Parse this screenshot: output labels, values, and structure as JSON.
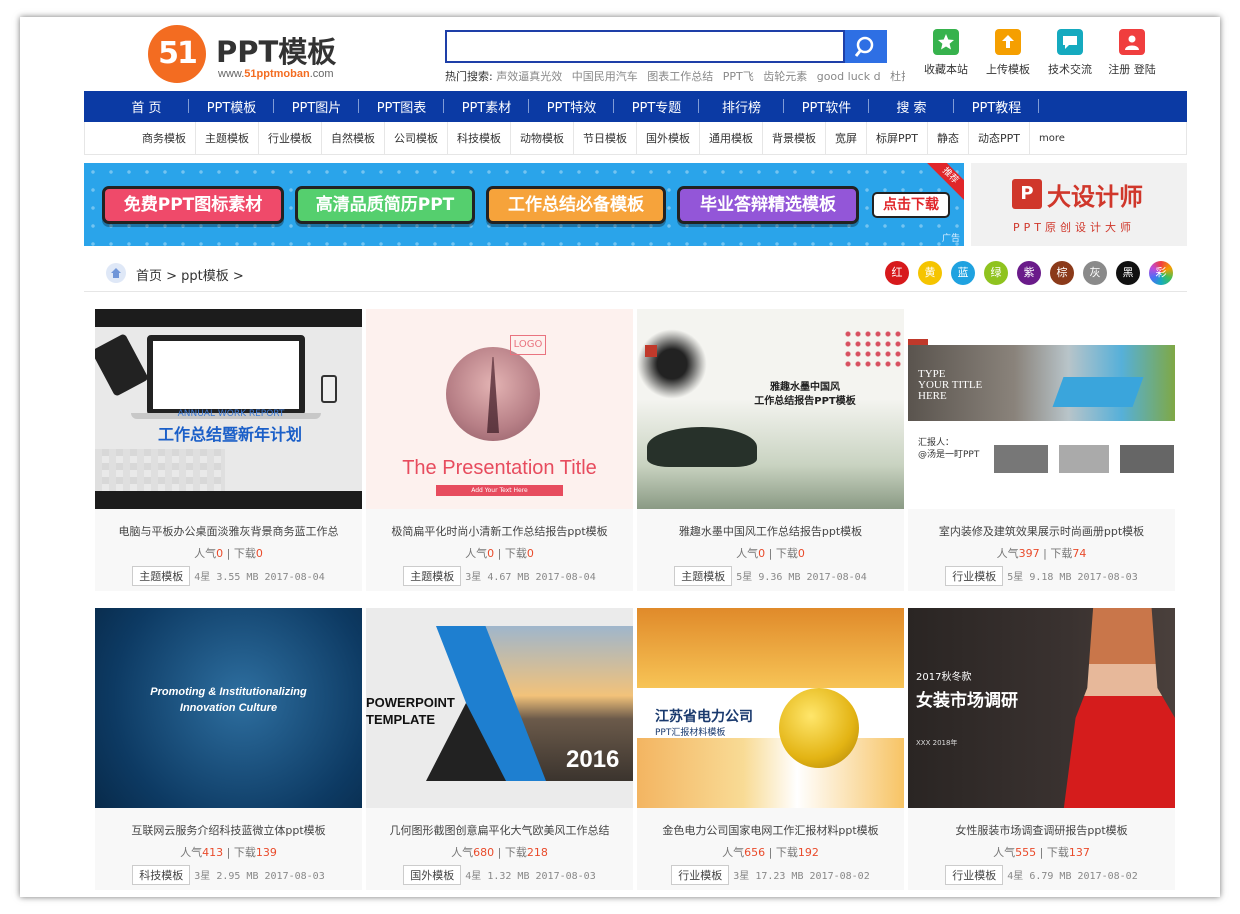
{
  "header": {
    "logo_mark": "51",
    "logo_title": "PPT模板",
    "logo_url_prefix": "www.",
    "logo_url_brand": "51pptmoban",
    "logo_url_suffix": ".com",
    "search_placeholder": "",
    "hot_label": "热门搜索:",
    "hot_keywords": [
      "声效逼真光效",
      "中国民用汽车",
      "图表工作总结",
      "PPT飞",
      "齿轮元素",
      "good luck d",
      "杜拉"
    ],
    "tools": [
      {
        "label": "收藏本站",
        "icon": "star-icon",
        "color": "#37b24d"
      },
      {
        "label": "上传模板",
        "icon": "upload-icon",
        "color": "#f59f00"
      },
      {
        "label": "技术交流",
        "icon": "chat-icon",
        "color": "#15aabf"
      },
      {
        "label": "注册 登陆",
        "icon": "user-icon",
        "color": "#f03e3e"
      }
    ]
  },
  "nav": [
    "首 页",
    "PPT模板",
    "PPT图片",
    "PPT图表",
    "PPT素材",
    "PPT特效",
    "PPT专题",
    "排行榜",
    "PPT软件",
    "搜 索",
    "PPT教程"
  ],
  "subnav": [
    "商务模板",
    "主题模板",
    "行业模板",
    "自然模板",
    "公司模板",
    "科技模板",
    "动物模板",
    "节日模板",
    "国外模板",
    "通用模板",
    "背景模板",
    "宽屏",
    "标屏PPT",
    "静态",
    "动态PPT",
    "more"
  ],
  "banner": {
    "pills": [
      "免费PPT图标素材",
      "高清品质简历PPT",
      "工作总结必备模板",
      "毕业答辩精选模板"
    ],
    "download": "点击下载",
    "ribbon": "推荐",
    "ad_tag": "广告",
    "side_logo": "P",
    "side_title": "大设计师",
    "side_sub": "PPT原创设计大师"
  },
  "breadcrumb": "首页 > ppt模板 >",
  "colors": [
    {
      "label": "红",
      "hex": "#d7191c"
    },
    {
      "label": "黄",
      "hex": "#f5c400"
    },
    {
      "label": "蓝",
      "hex": "#1fa2e0"
    },
    {
      "label": "绿",
      "hex": "#8fc31f"
    },
    {
      "label": "紫",
      "hex": "#6a1b8a"
    },
    {
      "label": "棕",
      "hex": "#8b3a1a"
    },
    {
      "label": "灰",
      "hex": "#8a8a8a"
    },
    {
      "label": "黑",
      "hex": "#111111"
    },
    {
      "label": "彩",
      "hex": "#ff6fa0"
    }
  ],
  "stat_labels": {
    "popularity": "人气",
    "downloads": "下载"
  },
  "cards": [
    {
      "title": "电脑与平板办公桌面淡雅灰背景商务蓝工作总",
      "popularity": "0",
      "downloads": "0",
      "tag": "主题模板",
      "rating": "4星",
      "size": "3.55 MB",
      "date": "2017-08-04",
      "thumb": {
        "small": "ANNUAL WORK REPORT",
        "big": "工作总结暨新年计划"
      }
    },
    {
      "title": "极简扁平化时尚小清新工作总结报告ppt模板",
      "popularity": "0",
      "downloads": "0",
      "tag": "主题模板",
      "rating": "3星",
      "size": "4.67 MB",
      "date": "2017-08-04",
      "thumb": {
        "logo": "LOGO",
        "title": "The Presentation Title",
        "bar": "Add Your Text Here"
      }
    },
    {
      "title": "雅趣水墨中国风工作总结报告ppt模板",
      "popularity": "0",
      "downloads": "0",
      "tag": "主题模板",
      "rating": "5星",
      "size": "9.36 MB",
      "date": "2017-08-04",
      "thumb": {
        "line1": "雅趣水墨中国风",
        "line2": "工作总结报告PPT模板"
      }
    },
    {
      "title": "室内装修及建筑效果展示时尚画册ppt模板",
      "popularity": "397",
      "downloads": "74",
      "tag": "行业模板",
      "rating": "5星",
      "size": "9.18 MB",
      "date": "2017-08-03",
      "thumb": {
        "line1": "TYPE",
        "line2": "YOUR TITLE",
        "line3": "HERE",
        "name1": "汇报人：",
        "name2": "@汤是一盯PPT"
      }
    },
    {
      "title": "互联网云服务介绍科技蓝微立体ppt模板",
      "popularity": "413",
      "downloads": "139",
      "tag": "科技模板",
      "rating": "3星",
      "size": "2.95 MB",
      "date": "2017-08-03",
      "thumb": {
        "line1": "Promoting & Institutionalizing",
        "line2": "Innovation Culture"
      }
    },
    {
      "title": "几何图形截图创意扁平化大气欧美风工作总结",
      "popularity": "680",
      "downloads": "218",
      "tag": "国外模板",
      "rating": "4星",
      "size": "1.32 MB",
      "date": "2017-08-03",
      "thumb": {
        "line1": "POWERPOINT",
        "line2": "TEMPLATE",
        "year": "2016"
      }
    },
    {
      "title": "金色电力公司国家电网工作汇报材料ppt模板",
      "popularity": "656",
      "downloads": "192",
      "tag": "行业模板",
      "rating": "3星",
      "size": "17.23 MB",
      "date": "2017-08-02",
      "thumb": {
        "name": "江苏省电力公司",
        "sub": "PPT汇报材料模板"
      }
    },
    {
      "title": "女性服装市场调查调研报告ppt模板",
      "popularity": "555",
      "downloads": "137",
      "tag": "行业模板",
      "rating": "4星",
      "size": "6.79 MB",
      "date": "2017-08-02",
      "thumb": {
        "small": "2017秋冬款",
        "big": "女装市场调研",
        "date": "XXX 2018年"
      }
    }
  ]
}
